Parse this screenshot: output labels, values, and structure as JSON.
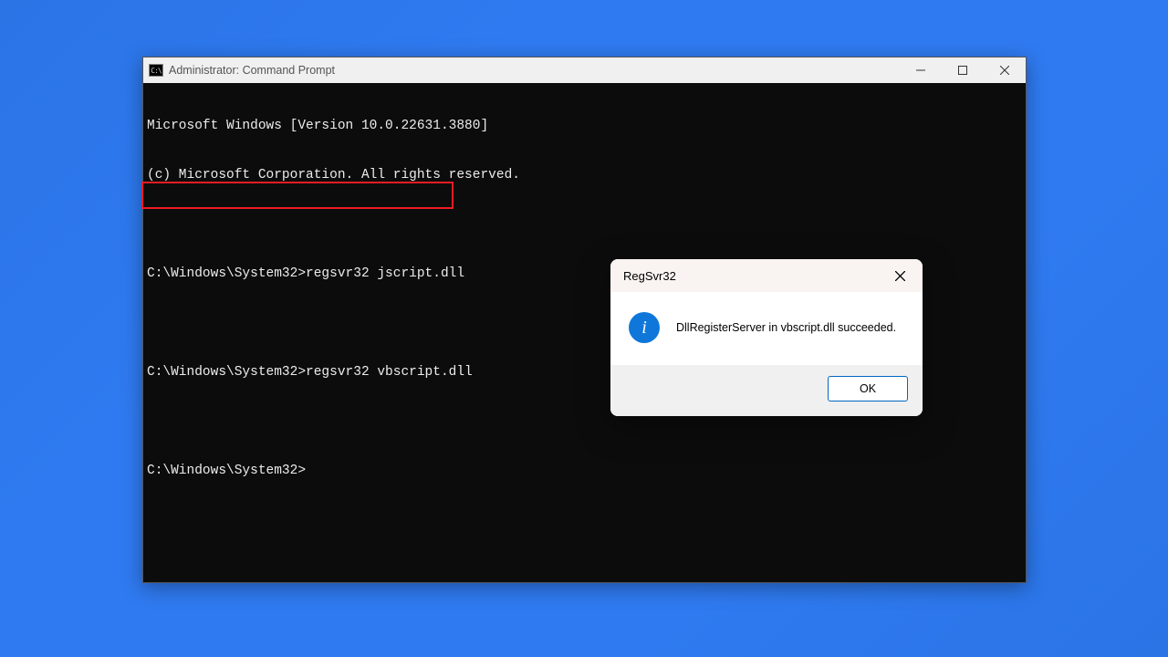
{
  "cmd": {
    "title": "Administrator: Command Prompt",
    "icon_label": "C:\\",
    "lines": {
      "l0": "Microsoft Windows [Version 10.0.22631.3880]",
      "l1": "(c) Microsoft Corporation. All rights reserved.",
      "l2": "C:\\Windows\\System32>regsvr32 jscript.dll",
      "l3": "C:\\Windows\\System32>regsvr32 vbscript.dll",
      "l4": "C:\\Windows\\System32>"
    },
    "window_buttons": {
      "minimize": "Minimize",
      "maximize": "Maximize",
      "close": "Close"
    }
  },
  "annotation": {
    "highlighted_command": "regsvr32 vbscript.dll"
  },
  "dialog": {
    "title": "RegSvr32",
    "message": "DllRegisterServer in vbscript.dll succeeded.",
    "ok_label": "OK",
    "close_label": "Close",
    "icon": "info"
  }
}
